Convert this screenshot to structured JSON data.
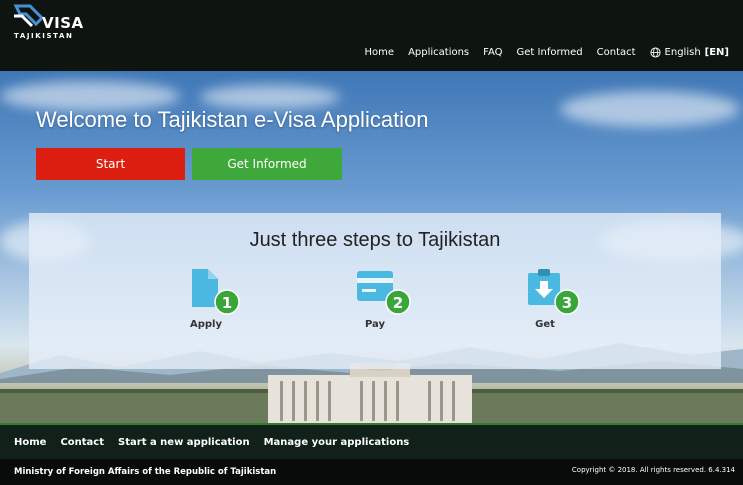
{
  "header": {
    "logo_text": "VISA",
    "logo_subtext": "TAJIKISTAN",
    "nav": [
      {
        "label": "Home"
      },
      {
        "label": "Applications"
      },
      {
        "label": "FAQ"
      },
      {
        "label": "Get Informed"
      },
      {
        "label": "Contact"
      }
    ],
    "language": {
      "label": "English",
      "code": "[EN]",
      "icon": "globe-icon"
    }
  },
  "hero": {
    "welcome": "Welcome to Tajikistan e-Visa Application",
    "start_label": "Start",
    "get_informed_label": "Get Informed"
  },
  "steps": {
    "title": "Just three steps to Tajikistan",
    "items": [
      {
        "label": "Apply",
        "number": "1",
        "icon": "document-icon"
      },
      {
        "label": "Pay",
        "number": "2",
        "icon": "credit-card-icon"
      },
      {
        "label": "Get",
        "number": "3",
        "icon": "download-clipboard-icon"
      }
    ]
  },
  "footer": {
    "nav": [
      {
        "label": "Home"
      },
      {
        "label": "Contact"
      },
      {
        "label": "Start a new application"
      },
      {
        "label": "Manage your applications"
      }
    ],
    "ministry": "Ministry of Foreign Affairs of the Republic of Tajikistan",
    "copyright": "Copyright © 2018. All rights reserved.  6.4.314"
  },
  "colors": {
    "start_button": "#dc1f10",
    "info_button": "#3fa83a",
    "step_icon": "#4ab8e0",
    "step_badge": "#3aa63a",
    "header_bg": "#0e1511"
  }
}
